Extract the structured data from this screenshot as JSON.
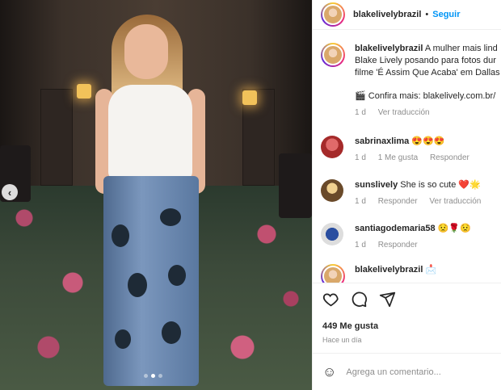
{
  "post": {
    "username": "blakelivelybrazil",
    "separator": "•",
    "follow_label": "Seguir"
  },
  "caption": {
    "username": "blakelivelybrazil",
    "text_line1": "A mulher mais lind",
    "text_line2": "Blake Lively posando para fotos dur",
    "text_line3": "filme 'É Assim Que Acaba' em Dallas",
    "link_line": "🎬 Confira mais: blakelively.com.br/",
    "time": "1 d",
    "translate": "Ver traducción"
  },
  "comments": [
    {
      "username": "sabrinaxlima",
      "text": "😍😍😍",
      "time": "1 d",
      "likes": "1 Me gusta",
      "reply": "Responder"
    },
    {
      "username": "sunslively",
      "text": "She is so cute ❤️🌟",
      "time": "1 d",
      "reply": "Responder",
      "translate": "Ver traducción"
    },
    {
      "username": "santiagodemaria58",
      "text": "😟🌹😟",
      "time": "1 d",
      "reply": "Responder"
    },
    {
      "username": "blakelivelybrazil",
      "text": "📩"
    }
  ],
  "actions": {
    "likes": "449 Me gusta",
    "timestamp": "Hace un día"
  },
  "composer": {
    "placeholder": "Agrega un comentario..."
  },
  "carousel": {
    "prev_glyph": "‹",
    "slide_count": 3,
    "active_index": 1
  }
}
